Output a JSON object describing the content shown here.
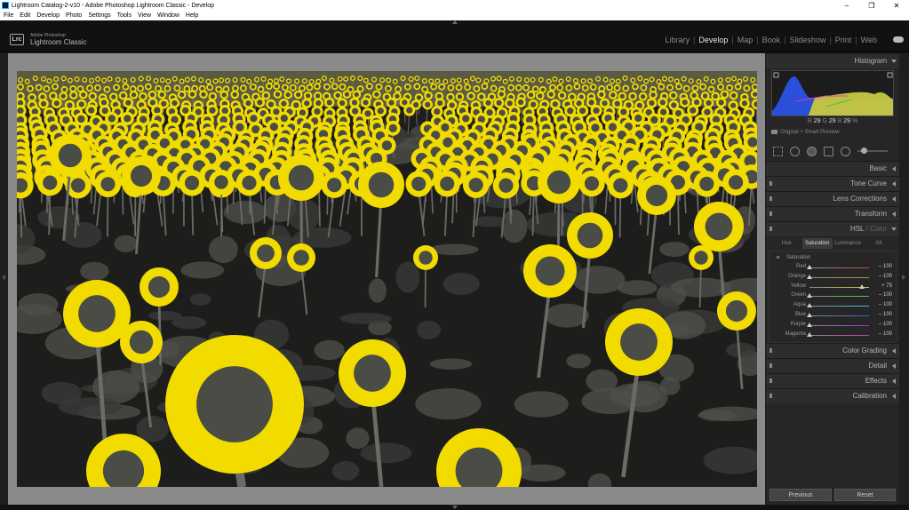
{
  "window": {
    "title": "Lightroom Catalog-2-v10 - Adobe Photoshop Lightroom Classic - Develop",
    "minimize": "–",
    "maximize": "❐",
    "close": "✕"
  },
  "menu": [
    "File",
    "Edit",
    "Develop",
    "Photo",
    "Settings",
    "Tools",
    "View",
    "Window",
    "Help"
  ],
  "identity": {
    "logo": "Lrc",
    "line1": "Adobe Photoshop",
    "line2": "Lightroom Classic"
  },
  "modules": [
    "Library",
    "Develop",
    "Map",
    "Book",
    "Slideshow",
    "Print",
    "Web"
  ],
  "active_module": "Develop",
  "histogram": {
    "title": "Histogram",
    "r_label": "R",
    "r_value": "29",
    "g_label": "G",
    "g_value": "29",
    "b_label": "B",
    "b_value": "29",
    "unit": "%",
    "preview_label": "Original + Smart Preview"
  },
  "panels": {
    "basic": "Basic",
    "tone_curve": "Tone Curve",
    "lens_corrections": "Lens Corrections",
    "transform": "Transform",
    "hsl": "HSL",
    "hsl_sep": " / ",
    "color": "Color",
    "color_grading": "Color Grading",
    "detail": "Detail",
    "effects": "Effects",
    "calibration": "Calibration"
  },
  "hsl_tabs": [
    "Hue",
    "Saturation",
    "Luminance",
    "All"
  ],
  "saturation": {
    "title": "Saturation",
    "sliders": [
      {
        "label": "Red",
        "value": "– 100",
        "level": -100,
        "color": "#c8463c"
      },
      {
        "label": "Orange",
        "value": "– 100",
        "level": -100,
        "color": "#c8823c"
      },
      {
        "label": "Yellow",
        "value": "+ 75",
        "level": 75,
        "color": "#c8c83c"
      },
      {
        "label": "Green",
        "value": "– 100",
        "level": -100,
        "color": "#3cc846"
      },
      {
        "label": "Aqua",
        "value": "– 100",
        "level": -100,
        "color": "#3cc8c8"
      },
      {
        "label": "Blue",
        "value": "– 100",
        "level": -100,
        "color": "#3c5ac8"
      },
      {
        "label": "Purple",
        "value": "– 100",
        "level": -100,
        "color": "#963cc8"
      },
      {
        "label": "Magenta",
        "value": "– 100",
        "level": -100,
        "color": "#c83cb4"
      }
    ]
  },
  "buttons": {
    "previous": "Previous",
    "reset": "Reset"
  },
  "colors": {
    "accent": "#e6e6e6",
    "sunflower": "#f2dc00"
  }
}
